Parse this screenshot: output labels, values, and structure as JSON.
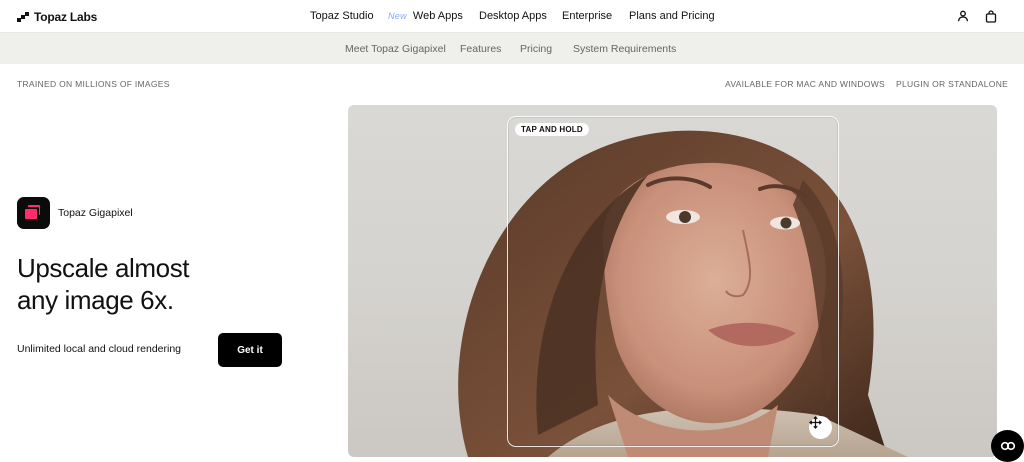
{
  "header": {
    "brand": "Topaz Labs",
    "nav": {
      "topaz_studio": "Topaz Studio",
      "new_tag": "New",
      "web_apps": "Web Apps",
      "desktop_apps": "Desktop Apps",
      "enterprise": "Enterprise",
      "plans_pricing": "Plans and Pricing"
    },
    "icons": {
      "account": "user-icon",
      "cart": "bag-icon"
    }
  },
  "subnav": {
    "meet": "Meet Topaz Gigapixel",
    "features": "Features",
    "pricing": "Pricing",
    "system": "System Requirements"
  },
  "meta": {
    "trained": "TRAINED ON MILLIONS OF IMAGES",
    "platforms": "AVAILABLE FOR MAC AND WINDOWS",
    "plugin": "PLUGIN OR STANDALONE"
  },
  "product": {
    "name": "Topaz Gigapixel",
    "headline_line1": "Upscale almost",
    "headline_line2": "any image 6x.",
    "subtext": "Unlimited local and cloud rendering",
    "cta": "Get it"
  },
  "hero": {
    "tap_label": "TAP AND HOLD",
    "handle_icon": "move-icon"
  },
  "chat": {
    "icon": "chat-icon"
  },
  "colors": {
    "accent": "#ff2d6f",
    "new_tag": "#8aa9ff",
    "subnav_bg": "#efefeb"
  }
}
